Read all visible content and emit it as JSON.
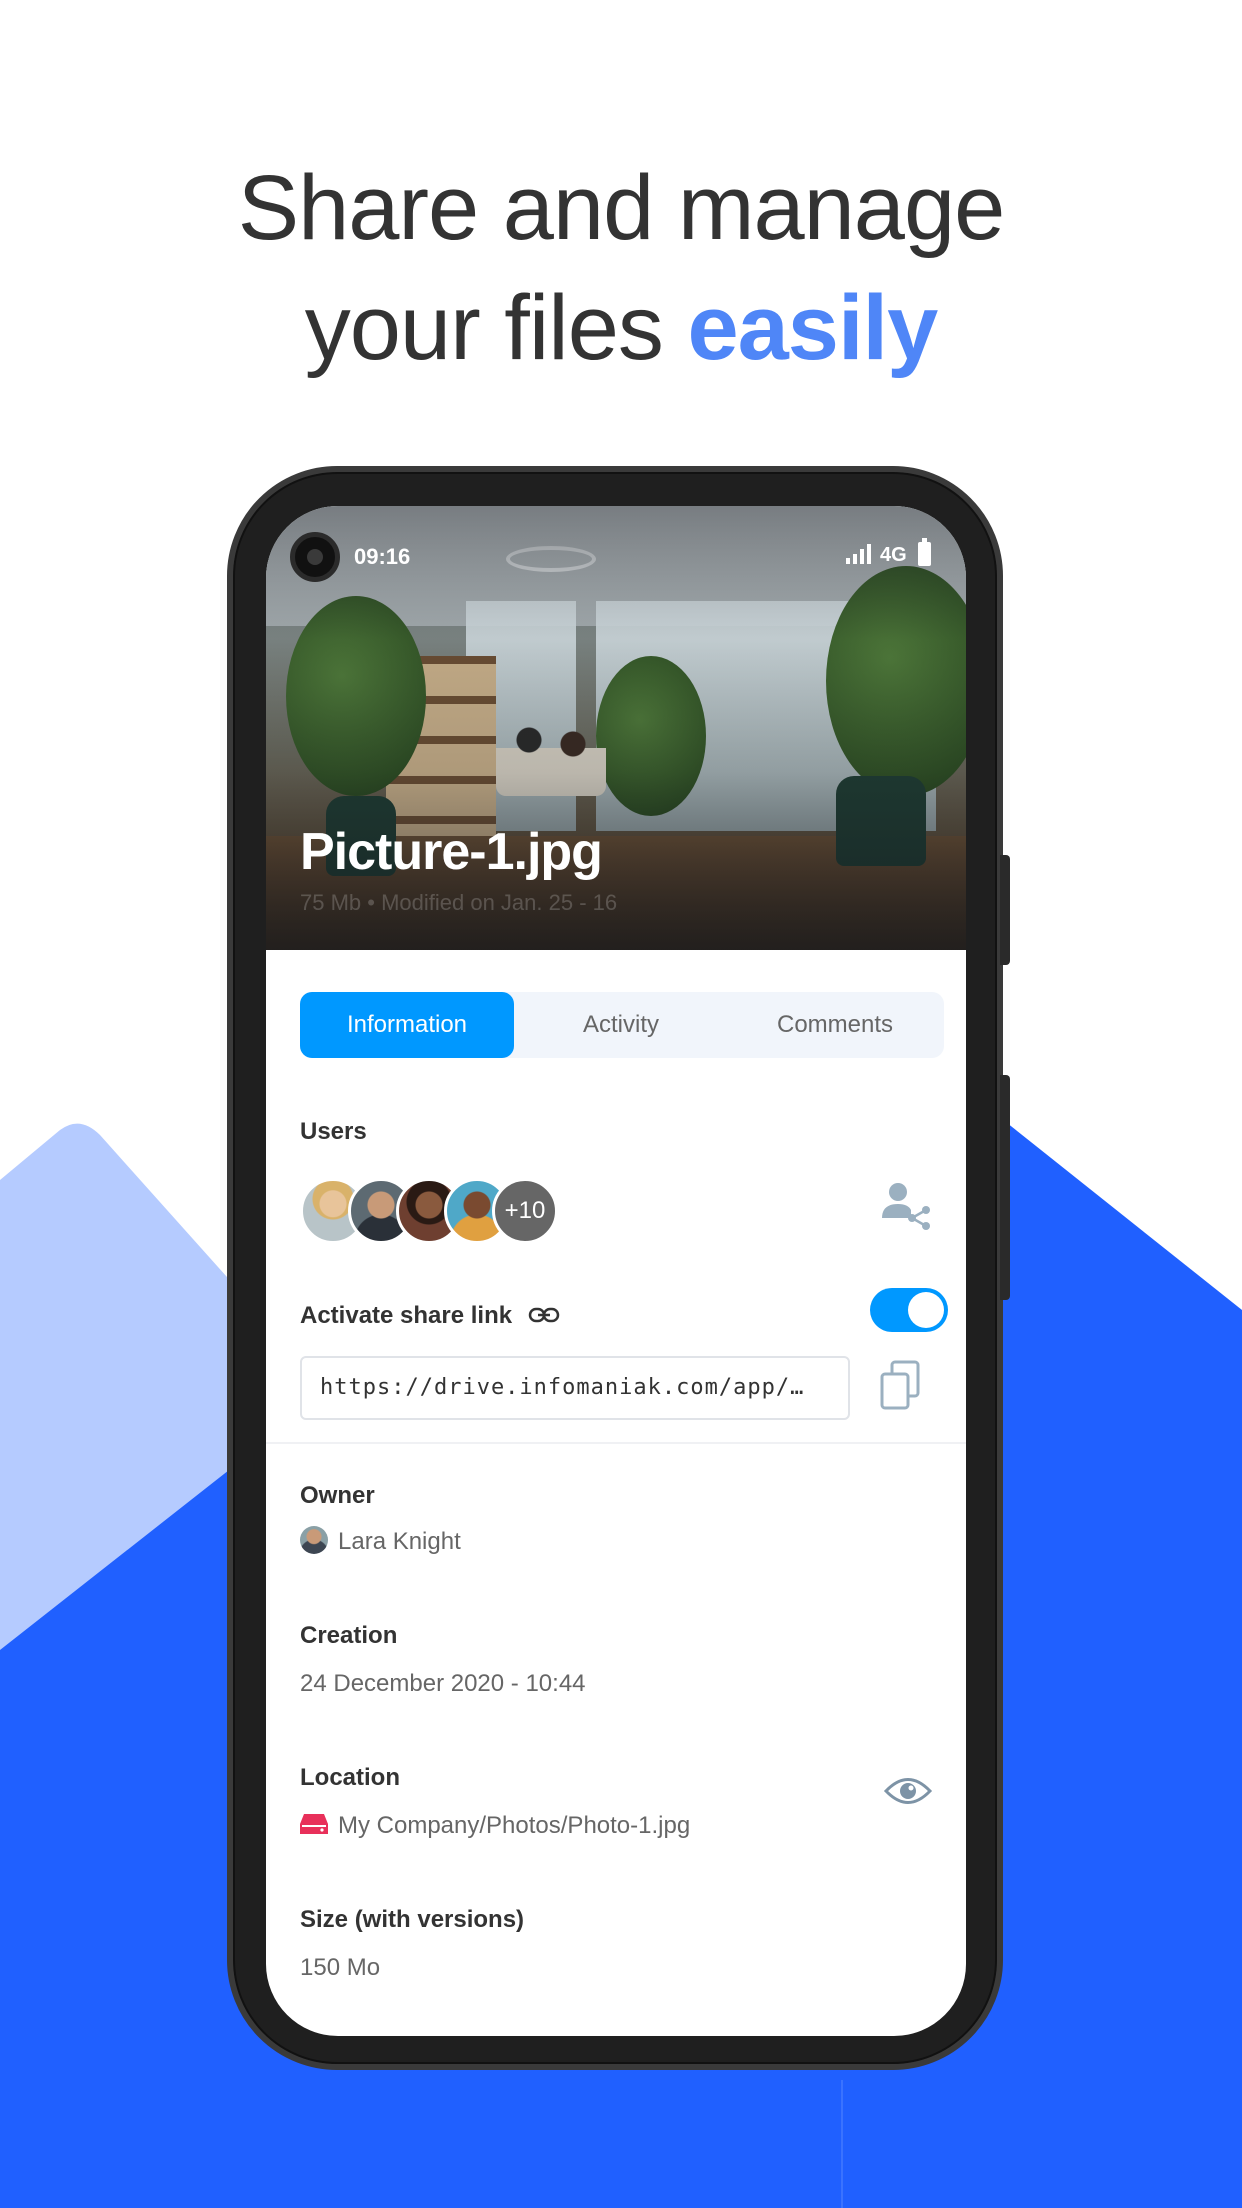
{
  "headline": {
    "line1": "Share and manage",
    "line2_prefix": "your files ",
    "line2_accent": "easily"
  },
  "colors": {
    "accent_blue": "#2060ff",
    "light_blue": "#b5cbff",
    "tab_active": "#0098ff",
    "headline_accent": "#4f86f7"
  },
  "status_bar": {
    "time": "09:16",
    "network": "4G"
  },
  "file": {
    "name": "Picture-1.jpg",
    "meta": "75 Mb • Modified on Jan. 25 - 16"
  },
  "tabs": [
    {
      "label": "Information",
      "active": true
    },
    {
      "label": "Activity",
      "active": false
    },
    {
      "label": "Comments",
      "active": false
    }
  ],
  "users": {
    "label": "Users",
    "more_count": "+10"
  },
  "share_link": {
    "label": "Activate share link",
    "enabled": true,
    "url": "https://drive.infomaniak.com/app/…"
  },
  "owner": {
    "label": "Owner",
    "name": "Lara Knight"
  },
  "creation": {
    "label": "Creation",
    "value": "24 December 2020 - 10:44"
  },
  "location": {
    "label": "Location",
    "value": "My Company/Photos/Photo-1.jpg"
  },
  "size": {
    "label": "Size (with versions)",
    "value": "150 Mo"
  },
  "icons": [
    "camera-icon",
    "signal-icon",
    "battery-icon",
    "link-icon",
    "share-user-icon",
    "copy-icon",
    "drive-icon",
    "eye-icon"
  ]
}
